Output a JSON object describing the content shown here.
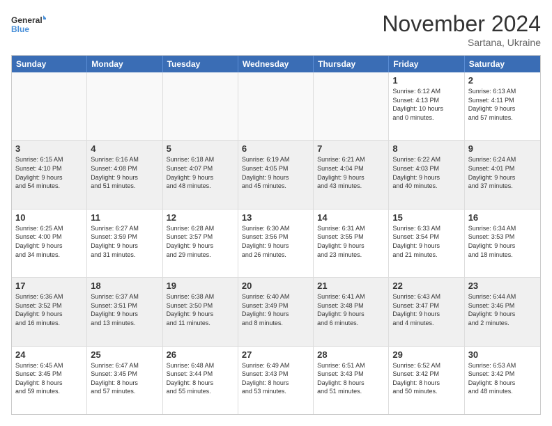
{
  "logo": {
    "text_general": "General",
    "text_blue": "Blue"
  },
  "header": {
    "month": "November 2024",
    "location": "Sartana, Ukraine"
  },
  "weekdays": [
    "Sunday",
    "Monday",
    "Tuesday",
    "Wednesday",
    "Thursday",
    "Friday",
    "Saturday"
  ],
  "rows": [
    [
      {
        "day": "",
        "info": "",
        "empty": true
      },
      {
        "day": "",
        "info": "",
        "empty": true
      },
      {
        "day": "",
        "info": "",
        "empty": true
      },
      {
        "day": "",
        "info": "",
        "empty": true
      },
      {
        "day": "",
        "info": "",
        "empty": true
      },
      {
        "day": "1",
        "info": "Sunrise: 6:12 AM\nSunset: 4:13 PM\nDaylight: 10 hours\nand 0 minutes.",
        "empty": false
      },
      {
        "day": "2",
        "info": "Sunrise: 6:13 AM\nSunset: 4:11 PM\nDaylight: 9 hours\nand 57 minutes.",
        "empty": false
      }
    ],
    [
      {
        "day": "3",
        "info": "Sunrise: 6:15 AM\nSunset: 4:10 PM\nDaylight: 9 hours\nand 54 minutes.",
        "empty": false
      },
      {
        "day": "4",
        "info": "Sunrise: 6:16 AM\nSunset: 4:08 PM\nDaylight: 9 hours\nand 51 minutes.",
        "empty": false
      },
      {
        "day": "5",
        "info": "Sunrise: 6:18 AM\nSunset: 4:07 PM\nDaylight: 9 hours\nand 48 minutes.",
        "empty": false
      },
      {
        "day": "6",
        "info": "Sunrise: 6:19 AM\nSunset: 4:05 PM\nDaylight: 9 hours\nand 45 minutes.",
        "empty": false
      },
      {
        "day": "7",
        "info": "Sunrise: 6:21 AM\nSunset: 4:04 PM\nDaylight: 9 hours\nand 43 minutes.",
        "empty": false
      },
      {
        "day": "8",
        "info": "Sunrise: 6:22 AM\nSunset: 4:03 PM\nDaylight: 9 hours\nand 40 minutes.",
        "empty": false
      },
      {
        "day": "9",
        "info": "Sunrise: 6:24 AM\nSunset: 4:01 PM\nDaylight: 9 hours\nand 37 minutes.",
        "empty": false
      }
    ],
    [
      {
        "day": "10",
        "info": "Sunrise: 6:25 AM\nSunset: 4:00 PM\nDaylight: 9 hours\nand 34 minutes.",
        "empty": false
      },
      {
        "day": "11",
        "info": "Sunrise: 6:27 AM\nSunset: 3:59 PM\nDaylight: 9 hours\nand 31 minutes.",
        "empty": false
      },
      {
        "day": "12",
        "info": "Sunrise: 6:28 AM\nSunset: 3:57 PM\nDaylight: 9 hours\nand 29 minutes.",
        "empty": false
      },
      {
        "day": "13",
        "info": "Sunrise: 6:30 AM\nSunset: 3:56 PM\nDaylight: 9 hours\nand 26 minutes.",
        "empty": false
      },
      {
        "day": "14",
        "info": "Sunrise: 6:31 AM\nSunset: 3:55 PM\nDaylight: 9 hours\nand 23 minutes.",
        "empty": false
      },
      {
        "day": "15",
        "info": "Sunrise: 6:33 AM\nSunset: 3:54 PM\nDaylight: 9 hours\nand 21 minutes.",
        "empty": false
      },
      {
        "day": "16",
        "info": "Sunrise: 6:34 AM\nSunset: 3:53 PM\nDaylight: 9 hours\nand 18 minutes.",
        "empty": false
      }
    ],
    [
      {
        "day": "17",
        "info": "Sunrise: 6:36 AM\nSunset: 3:52 PM\nDaylight: 9 hours\nand 16 minutes.",
        "empty": false
      },
      {
        "day": "18",
        "info": "Sunrise: 6:37 AM\nSunset: 3:51 PM\nDaylight: 9 hours\nand 13 minutes.",
        "empty": false
      },
      {
        "day": "19",
        "info": "Sunrise: 6:38 AM\nSunset: 3:50 PM\nDaylight: 9 hours\nand 11 minutes.",
        "empty": false
      },
      {
        "day": "20",
        "info": "Sunrise: 6:40 AM\nSunset: 3:49 PM\nDaylight: 9 hours\nand 8 minutes.",
        "empty": false
      },
      {
        "day": "21",
        "info": "Sunrise: 6:41 AM\nSunset: 3:48 PM\nDaylight: 9 hours\nand 6 minutes.",
        "empty": false
      },
      {
        "day": "22",
        "info": "Sunrise: 6:43 AM\nSunset: 3:47 PM\nDaylight: 9 hours\nand 4 minutes.",
        "empty": false
      },
      {
        "day": "23",
        "info": "Sunrise: 6:44 AM\nSunset: 3:46 PM\nDaylight: 9 hours\nand 2 minutes.",
        "empty": false
      }
    ],
    [
      {
        "day": "24",
        "info": "Sunrise: 6:45 AM\nSunset: 3:45 PM\nDaylight: 8 hours\nand 59 minutes.",
        "empty": false
      },
      {
        "day": "25",
        "info": "Sunrise: 6:47 AM\nSunset: 3:45 PM\nDaylight: 8 hours\nand 57 minutes.",
        "empty": false
      },
      {
        "day": "26",
        "info": "Sunrise: 6:48 AM\nSunset: 3:44 PM\nDaylight: 8 hours\nand 55 minutes.",
        "empty": false
      },
      {
        "day": "27",
        "info": "Sunrise: 6:49 AM\nSunset: 3:43 PM\nDaylight: 8 hours\nand 53 minutes.",
        "empty": false
      },
      {
        "day": "28",
        "info": "Sunrise: 6:51 AM\nSunset: 3:43 PM\nDaylight: 8 hours\nand 51 minutes.",
        "empty": false
      },
      {
        "day": "29",
        "info": "Sunrise: 6:52 AM\nSunset: 3:42 PM\nDaylight: 8 hours\nand 50 minutes.",
        "empty": false
      },
      {
        "day": "30",
        "info": "Sunrise: 6:53 AM\nSunset: 3:42 PM\nDaylight: 8 hours\nand 48 minutes.",
        "empty": false
      }
    ]
  ]
}
